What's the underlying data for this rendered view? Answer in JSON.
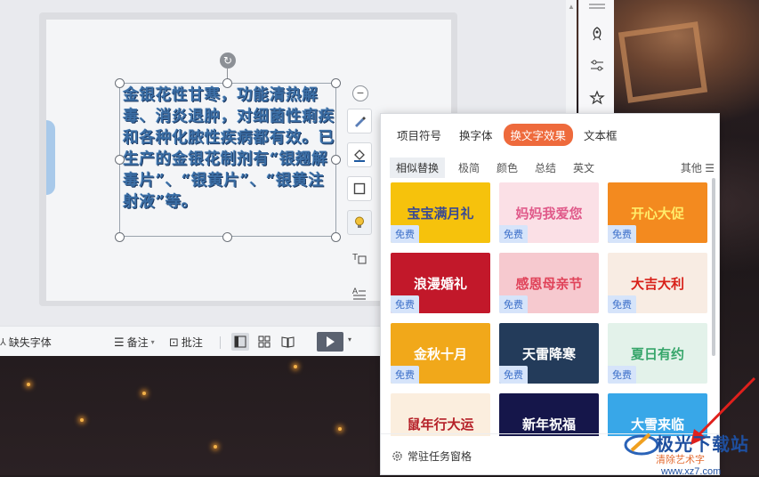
{
  "slide": {
    "text": "金银花性甘寒，功能清热解毒、消炎退肿，对细菌性痢疾和各种化脓性疾病都有效。已生产的金银花制剂有“银翘解毒片”、“银黄片”、“银黄注射液”等。"
  },
  "statusbar": {
    "missing_font": "缺失字体",
    "notes": "备注",
    "comments": "批注"
  },
  "panel": {
    "tabs": [
      "项目符号",
      "换字体",
      "换文字效果",
      "文本框"
    ],
    "active_tab": "换文字效果",
    "subtabs": [
      "相似替换",
      "极简",
      "颜色",
      "总结",
      "英文"
    ],
    "more": "其他",
    "free_label": "免费",
    "cards": [
      {
        "title": "宝宝满月礼",
        "bg": "#f6c20c",
        "color": "#3a4a92"
      },
      {
        "title": "妈妈我爱您",
        "bg": "#fbe0e6",
        "color": "#e05a8a"
      },
      {
        "title": "开心大促",
        "bg": "#f38a1f",
        "color": "#ffec6a"
      },
      {
        "title": "浪漫婚礼",
        "bg": "#c2182a",
        "color": "#ffffff"
      },
      {
        "title": "感恩母亲节",
        "bg": "#f6c9cf",
        "color": "#e0435a"
      },
      {
        "title": "大吉大利",
        "bg": "#f8ece3",
        "color": "#d8211a"
      },
      {
        "title": "金秋十月",
        "bg": "#f1a81a",
        "color": "#ffffff"
      },
      {
        "title": "天雷降寒",
        "bg": "#233b5a",
        "color": "#ffffff"
      },
      {
        "title": "夏日有约",
        "bg": "#e3f2ea",
        "color": "#37a66b"
      },
      {
        "title": "鼠年行大运",
        "bg": "#fbeede",
        "color": "#b52028"
      },
      {
        "title": "新年祝福",
        "bg": "#15164a",
        "color": "#ffffff"
      },
      {
        "title": "大雪来临",
        "bg": "#38a7e8",
        "color": "#ffffff"
      }
    ],
    "footer_pin": "常驻任务窗格"
  },
  "watermark": {
    "title": "极光下载站",
    "subtitle": "清除艺术字",
    "url": "www.xz7.com"
  }
}
